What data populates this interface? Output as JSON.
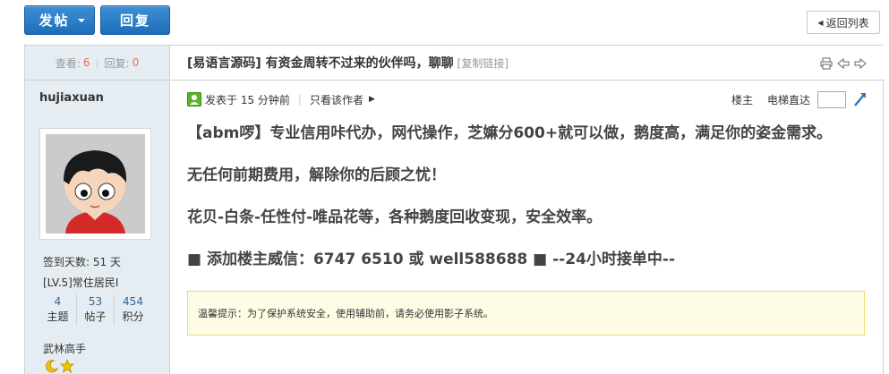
{
  "toolbar": {
    "post_label": "发帖",
    "reply_label": "回复",
    "back_label": "返回列表"
  },
  "sidebar": {
    "views_label": "查看:",
    "views_value": "6",
    "replies_label": "回复:",
    "replies_value": "0",
    "username": "hujiaxuan",
    "signin_days": "签到天数: 51 天",
    "level": "[LV.5]常住居民I",
    "stats": [
      {
        "value": "4",
        "label": "主题"
      },
      {
        "value": "53",
        "label": "帖子"
      },
      {
        "value": "454",
        "label": "积分"
      }
    ],
    "rank": "武林高手"
  },
  "thread": {
    "title": "[易语言源码] 有资金周转不过来的伙伴吗，聊聊",
    "copy_link": "[复制链接]",
    "posted": "发表于 15 分钟前",
    "only_author": "只看该作者",
    "floor_owner": "楼主",
    "elevator": "电梯直达"
  },
  "post": {
    "lines": [
      "【abm啰】专业信用咔代办，网代操作，芝嫲分600+就可以做，鹅度高，满足你的姿金需求。",
      "无任何前期费用，解除你的后顾之忧！",
      "花贝-白条-任性付-唯品花等，各种鹅度回收变现，安全效率。",
      "■ 添加楼主威信：6747 6510 或 well588688 ■ --24小时接单中--"
    ],
    "notice": "温馨提示：为了保护系统安全，使用辅助前，请务必使用影子系统。"
  },
  "colors": {
    "accent_blue": "#2a7bc8",
    "sidebar_bg": "#e5edf2",
    "highlight_red": "#f26c4f",
    "notice_bg": "#fffce6",
    "notice_border": "#f2d96b"
  }
}
